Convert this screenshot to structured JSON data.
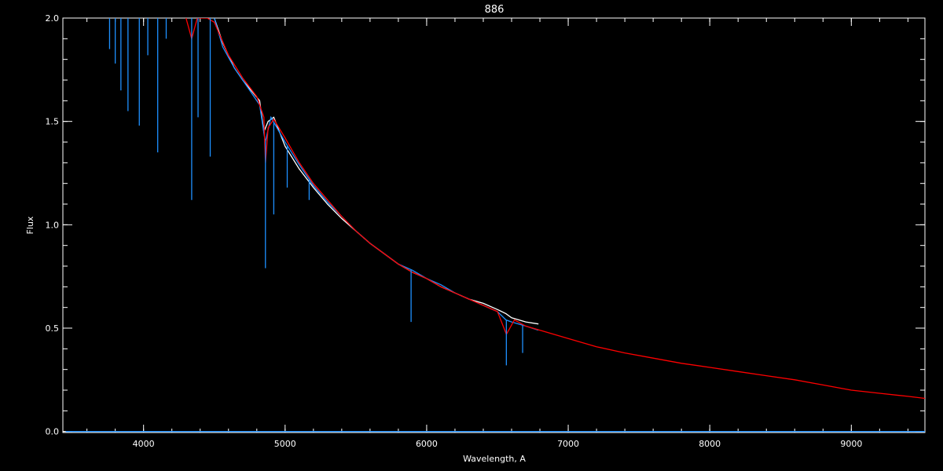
{
  "chart_data": {
    "type": "line",
    "title": "886",
    "xlabel": "Wavelength, A",
    "ylabel": "Flux",
    "xlim": [
      3430,
      9520
    ],
    "ylim": [
      -0.005,
      2.0
    ],
    "x_ticks": [
      {
        "value": 4000,
        "label": "4000"
      },
      {
        "value": 5000,
        "label": "5000"
      },
      {
        "value": 6000,
        "label": "6000"
      },
      {
        "value": 7000,
        "label": "7000"
      },
      {
        "value": 8000,
        "label": "8000"
      },
      {
        "value": 9000,
        "label": "9000"
      }
    ],
    "x_minor_step": 200,
    "y_ticks": [
      {
        "value": 0.0,
        "label": "0.0"
      },
      {
        "value": 0.5,
        "label": "0.5"
      },
      {
        "value": 1.0,
        "label": "1.0"
      },
      {
        "value": 1.5,
        "label": "1.5"
      },
      {
        "value": 2.0,
        "label": "2.0"
      }
    ],
    "y_minor_step": 0.1,
    "grid": false,
    "legend": "none",
    "colors": {
      "background": "#000000",
      "axes": "#ffffff"
    },
    "series": [
      {
        "color": "#ffffff",
        "x": [
          4500,
          4560,
          4640,
          4700,
          4760,
          4820,
          4850,
          4880,
          4920,
          5000,
          5100,
          5200,
          5300,
          5400,
          5500,
          5600,
          5700,
          5800,
          5900,
          6000,
          6100,
          6200,
          6300,
          6400,
          6500,
          6560,
          6600,
          6700,
          6790
        ],
        "y": [
          2.0,
          1.88,
          1.76,
          1.7,
          1.65,
          1.6,
          1.45,
          1.5,
          1.52,
          1.38,
          1.27,
          1.18,
          1.1,
          1.03,
          0.97,
          0.91,
          0.86,
          0.81,
          0.77,
          0.74,
          0.7,
          0.67,
          0.64,
          0.62,
          0.59,
          0.57,
          0.55,
          0.53,
          0.52
        ]
      },
      {
        "color": "#1e90ff",
        "x": [
          4500,
          4560,
          4640,
          4700,
          4760,
          4820,
          4860,
          4900,
          5000,
          5100,
          5200,
          5300,
          5400,
          5500,
          5600,
          5700,
          5800,
          5900,
          6000,
          6100,
          6200,
          6300,
          6400,
          6500,
          6560,
          6600,
          6700,
          6790
        ],
        "y": [
          2.0,
          1.86,
          1.76,
          1.7,
          1.64,
          1.58,
          1.4,
          1.52,
          1.4,
          1.29,
          1.19,
          1.11,
          1.04,
          0.97,
          0.91,
          0.86,
          0.81,
          0.78,
          0.74,
          0.71,
          0.67,
          0.64,
          0.61,
          0.58,
          0.54,
          0.53,
          0.51,
          0.49
        ]
      },
      {
        "color": "#ff0000",
        "x": [
          4300,
          4340,
          4380,
          4450,
          4500,
          4600,
          4700,
          4800,
          4850,
          4861,
          4880,
          4920,
          5000,
          5100,
          5200,
          5300,
          5400,
          5500,
          5600,
          5700,
          5800,
          5900,
          6000,
          6100,
          6200,
          6300,
          6400,
          6500,
          6563,
          6620,
          6700,
          6800,
          7000,
          7200,
          7400,
          7600,
          7800,
          8000,
          8200,
          8400,
          8600,
          8800,
          9000,
          9200,
          9400,
          9520
        ],
        "y": [
          2.0,
          1.9,
          2.0,
          2.0,
          1.98,
          1.82,
          1.71,
          1.62,
          1.52,
          1.3,
          1.47,
          1.51,
          1.42,
          1.3,
          1.2,
          1.12,
          1.04,
          0.97,
          0.91,
          0.86,
          0.81,
          0.77,
          0.74,
          0.7,
          0.67,
          0.64,
          0.61,
          0.58,
          0.47,
          0.54,
          0.51,
          0.49,
          0.45,
          0.41,
          0.38,
          0.355,
          0.33,
          0.31,
          0.29,
          0.27,
          0.25,
          0.225,
          0.2,
          0.185,
          0.17,
          0.16
        ]
      },
      {
        "color": "#1e90ff",
        "x": [
          3450,
          4000,
          4500,
          5000,
          6000,
          7000,
          8000,
          9000,
          9520
        ],
        "y": [
          0.0,
          0.0,
          0.0,
          0.0,
          0.0,
          0.0,
          0.0,
          0.0,
          0.0
        ]
      }
    ],
    "absorption_lines": [
      {
        "color": "#1e90ff",
        "x": [
          3760,
          3800,
          3840,
          3890,
          3970,
          4030,
          4100,
          4160,
          4340,
          4385,
          4471,
          4861,
          4920,
          5015,
          5170,
          5890,
          6563,
          6678
        ],
        "y": [
          1.85,
          1.78,
          1.65,
          1.55,
          1.48,
          1.82,
          1.35,
          1.9,
          1.12,
          1.52,
          1.33,
          0.79,
          1.05,
          1.18,
          1.12,
          0.53,
          0.32,
          0.38
        ]
      }
    ]
  }
}
